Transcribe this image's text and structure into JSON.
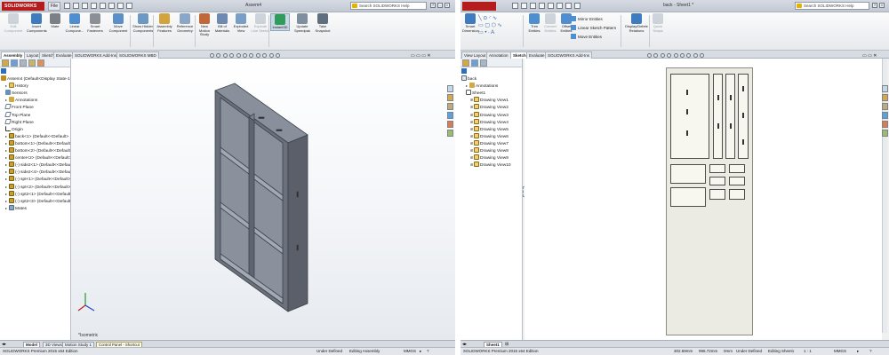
{
  "left": {
    "title": "Assem4",
    "logo": "SOLIDWORKS",
    "file_menu": "File",
    "search": "Search SOLIDWORKS Help",
    "ribbon": [
      {
        "name": "edit-component-button",
        "icon": "edit-component-icon",
        "label": "Edit Component",
        "color": "#9aa6b4",
        "disabled": true
      },
      {
        "name": "insert-components-button",
        "icon": "insert-components-icon",
        "label": "Insert Components",
        "color": "#3e7bbf"
      },
      {
        "name": "mate-button",
        "icon": "mate-icon",
        "label": "Mate",
        "color": "#7b7f86"
      },
      {
        "name": "linear-component-pattern-button",
        "icon": "linear-pattern-icon",
        "label": "Linear Compone...",
        "color": "#4f8fcf"
      },
      {
        "name": "smart-fasteners-button",
        "icon": "smart-fasteners-icon",
        "label": "Smart Fasteners",
        "color": "#8b8f96"
      },
      {
        "name": "move-component-button",
        "icon": "move-component-icon",
        "label": "Move Component",
        "color": "#5a8fc8"
      },
      {
        "name": "show-hidden-components-button",
        "icon": "show-hidden-icon",
        "label": "Show Hidden Components",
        "color": "#6e98c4"
      },
      {
        "name": "assembly-features-button",
        "icon": "assembly-features-icon",
        "label": "Assembly Features",
        "color": "#d3a43d"
      },
      {
        "name": "reference-geometry-button",
        "icon": "reference-geometry-icon",
        "label": "Reference Geometry",
        "color": "#8aa7c8"
      },
      {
        "name": "new-motion-study-button",
        "icon": "motion-study-icon",
        "label": "New Motion Study",
        "color": "#c0683a"
      },
      {
        "name": "bill-of-materials-button",
        "icon": "bom-icon",
        "label": "Bill of Materials",
        "color": "#6f8ab0"
      },
      {
        "name": "exploded-view-button",
        "icon": "exploded-view-icon",
        "label": "Exploded View",
        "color": "#7a9fc7"
      },
      {
        "name": "explode-line-sketch-button",
        "icon": "explode-line-icon",
        "label": "Explode Line Sketch",
        "color": "#9aa6b4",
        "disabled": true
      },
      {
        "name": "instant3d-button",
        "icon": "instant3d-icon",
        "label": "Instant3D",
        "color": "#2f9c5c",
        "active": true
      },
      {
        "name": "update-speedpak-button",
        "icon": "speedpak-icon",
        "label": "Update Speedpak",
        "color": "#7f8fa0"
      },
      {
        "name": "take-snapshot-button",
        "icon": "snapshot-icon",
        "label": "Take Snapshot",
        "color": "#5f6f80"
      }
    ],
    "tabs": [
      "Assembly",
      "Layout",
      "Sketch",
      "Evaluate",
      "SOLIDWORKS Add-Ins",
      "SOLIDWORKS MBD"
    ],
    "active_tab": "Assembly",
    "tree": [
      {
        "text": "Assem4 (Default<Display State-1>",
        "icon": "asm",
        "indent": 0
      },
      {
        "text": "History",
        "icon": "folder",
        "indent": 1
      },
      {
        "text": "Sensors",
        "icon": "sensor",
        "indent": 1
      },
      {
        "text": "Annotations",
        "icon": "anno",
        "indent": 1
      },
      {
        "text": "Front Plane",
        "icon": "plane",
        "indent": 1
      },
      {
        "text": "Top Plane",
        "icon": "plane",
        "indent": 1
      },
      {
        "text": "Right Plane",
        "icon": "plane",
        "indent": 1
      },
      {
        "text": "Origin",
        "icon": "origin",
        "indent": 1
      },
      {
        "text": "back<1> (Default<<Default>",
        "icon": "part",
        "indent": 1
      },
      {
        "text": "bottom<1> (Default<<Default>",
        "icon": "part",
        "indent": 1
      },
      {
        "text": "bottom<2> (Default<<Default>",
        "icon": "part",
        "indent": 1
      },
      {
        "text": "center<2> (Default<<Default>_",
        "icon": "part",
        "indent": 1
      },
      {
        "text": "(-) side2<1> (Default<<Defau",
        "icon": "part",
        "indent": 1
      },
      {
        "text": "(-) side2<4> (Default<<Default>",
        "icon": "part",
        "indent": 1
      },
      {
        "text": "(-) spt<1> (Default<<Default>",
        "icon": "part",
        "indent": 1
      },
      {
        "text": "(-) spt<2> (Default<<Default>",
        "icon": "part",
        "indent": 1
      },
      {
        "text": "(-) spt2<1> (Default<<Default>",
        "icon": "part",
        "indent": 1
      },
      {
        "text": "(-) spt2<3> (Default<<Default>",
        "icon": "part",
        "indent": 1
      },
      {
        "text": "Mates",
        "icon": "mates",
        "indent": 1
      }
    ],
    "view_label": "*Isometric",
    "bottom_tabs": [
      "Model",
      "3D Views",
      "Motion Study 1"
    ],
    "tooltip": "Control Panel - Shortcut",
    "status": {
      "edition": "SOLIDWORKS Premium 2015 x64 Edition",
      "state": "Under Defined",
      "mode": "Editing Assembly",
      "units": "MMGS"
    }
  },
  "right": {
    "title": "back - Sheet1 *",
    "search": "Search SOLIDWORKS Help",
    "ribbon_big": [
      {
        "name": "smart-dimension-button",
        "icon": "smart-dimension-icon",
        "label": "Smart Dimension",
        "color": "#3e7bbf"
      },
      {
        "name": "trim-entities-button",
        "icon": "trim-icon",
        "label": "Trim Entities",
        "color": "#4f8fcf"
      },
      {
        "name": "convert-entities-button",
        "icon": "convert-entities-icon",
        "label": "Convert Entities",
        "color": "#9aa6b4",
        "disabled": true
      },
      {
        "name": "offset-entities-button",
        "icon": "offset-icon",
        "label": "Offset Entities",
        "color": "#4f8fcf"
      }
    ],
    "ribbon_small": [
      "Mirror Entities",
      "Linear Sketch Pattern",
      "Move Entities"
    ],
    "ribbon_big2": [
      {
        "name": "display-delete-relations-button",
        "icon": "relations-icon",
        "label": "Display/Delete Relations",
        "color": "#3e7bbf"
      },
      {
        "name": "quick-snaps-button",
        "icon": "quick-snaps-icon",
        "label": "Quick Snaps",
        "color": "#9aa6b4",
        "disabled": true
      }
    ],
    "tabs": [
      "View Layout",
      "Annotation",
      "Sketch",
      "Evaluate",
      "SOLIDWORKS Add-Ins"
    ],
    "active_tab": "Sketch",
    "tree": [
      {
        "text": "back",
        "icon": "drw",
        "indent": 0
      },
      {
        "text": "Annotations",
        "icon": "anno",
        "indent": 1
      },
      {
        "text": "Sheet1",
        "icon": "sheet",
        "indent": 1
      },
      {
        "text": "Drawing View1",
        "icon": "view",
        "indent": 2
      },
      {
        "text": "Drawing View2",
        "icon": "view",
        "indent": 2
      },
      {
        "text": "Drawing View3",
        "icon": "view",
        "indent": 2
      },
      {
        "text": "Drawing View4",
        "icon": "view",
        "indent": 2
      },
      {
        "text": "Drawing View5",
        "icon": "view",
        "indent": 2
      },
      {
        "text": "Drawing View6",
        "icon": "view",
        "indent": 2
      },
      {
        "text": "Drawing View7",
        "icon": "view",
        "indent": 2
      },
      {
        "text": "Drawing View8",
        "icon": "view",
        "indent": 2
      },
      {
        "text": "Drawing View9",
        "icon": "view",
        "indent": 2
      },
      {
        "text": "Drawing View10",
        "icon": "view",
        "indent": 2
      }
    ],
    "bottom_tab": "Sheet1",
    "status": {
      "edition": "SOLIDWORKS Premium 2015 x64 Edition",
      "x": "302.69mm",
      "y": "996.72mm",
      "z": "0mm",
      "state": "Under Defined",
      "mode": "Editing Sheet1",
      "scale": "1 : 1",
      "units": "MMGS"
    }
  }
}
